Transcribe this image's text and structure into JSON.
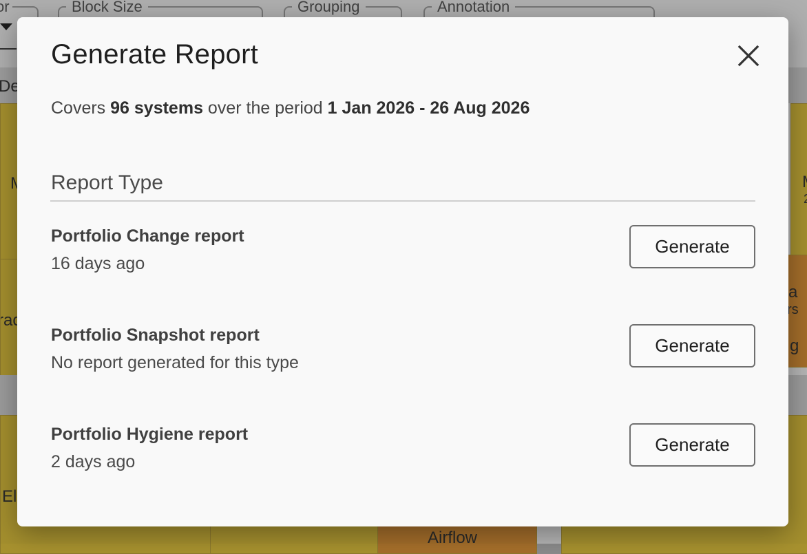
{
  "background": {
    "toolbar": {
      "fields": [
        {
          "label": "or"
        },
        {
          "label": "Block Size"
        },
        {
          "label": "Grouping"
        },
        {
          "label": "Annotation"
        }
      ]
    },
    "fragments": {
      "group_header": "De",
      "tile_m_left": "M",
      "tile_m_right": "M",
      "tile_m_right_sub": "2",
      "tile_tra": "rac",
      "tile_a": "a",
      "tile_rs": "rs",
      "tile_g": "g",
      "tile_el": "El",
      "tile_airflow": "Airflow"
    },
    "colors": {
      "tile_gold": "#a8922f",
      "tile_orange": "#a7702b"
    }
  },
  "dialog": {
    "title": "Generate Report",
    "close_icon": "close-icon",
    "summary": {
      "prefix": "Covers",
      "systems": "96 systems",
      "middle": "over the period",
      "period": "1 Jan 2026 - 26 Aug 2026"
    },
    "section_title": "Report Type",
    "reports": [
      {
        "name": "Portfolio Change report",
        "status": "16 days ago",
        "button": "Generate"
      },
      {
        "name": "Portfolio Snapshot report",
        "status": "No report generated for this type",
        "button": "Generate"
      },
      {
        "name": "Portfolio Hygiene report",
        "status": "2 days ago",
        "button": "Generate"
      }
    ]
  }
}
